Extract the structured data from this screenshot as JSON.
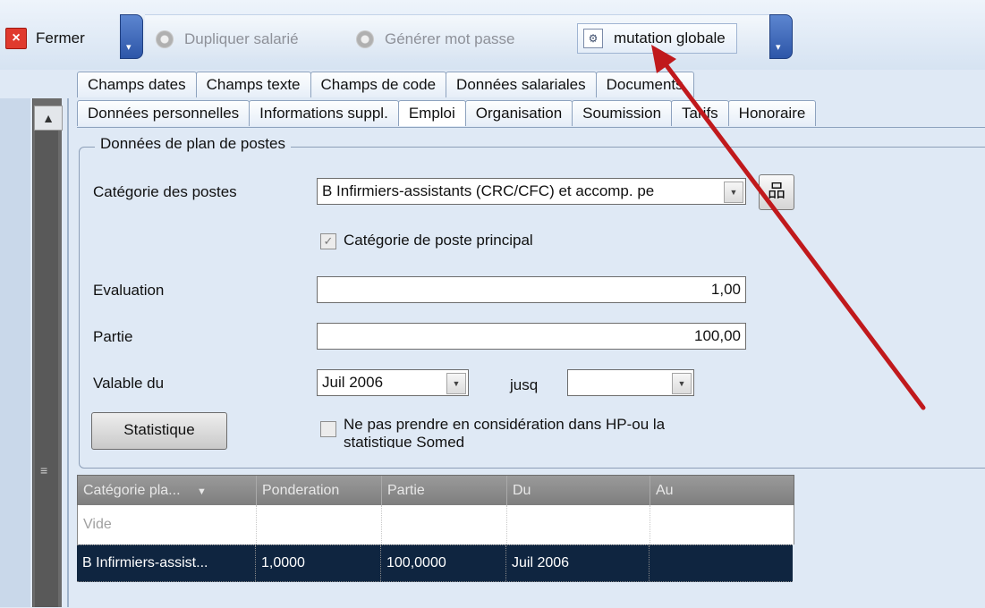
{
  "toolbar": {
    "close_label": "Fermer",
    "duplicate_label": "Dupliquer salarié",
    "generate_password_label": "Générer mot passe",
    "mutation_label": "mutation globale",
    "split_arrow": "▾"
  },
  "tabs_row1": [
    "Champs dates",
    "Champs texte",
    "Champs de code",
    "Données salariales",
    "Documents"
  ],
  "tabs_row2": [
    "Données personnelles",
    "Informations suppl.",
    "Emploi",
    "Organisation",
    "Soumission",
    "Tarifs",
    "Honoraire"
  ],
  "groupbox": {
    "title": "Données de plan de postes",
    "category_label": "Catégorie des postes",
    "category_value": "B Infirmiers-assistants (CRC/CFC) et accomp. pe",
    "main_category_label": "Catégorie de poste principal",
    "main_category_checked": "✓",
    "evaluation_label": "Evaluation",
    "evaluation_value": "1,00",
    "partie_label": "Partie",
    "partie_value": "100,00",
    "valid_from_label": "Valable du",
    "valid_from_value": "Juil 2006",
    "until_label": "jusq",
    "until_value": "",
    "statistic_button": "Statistique",
    "exclude_label_line1": "Ne pas prendre en considération dans HP-ou la",
    "exclude_label_line2": "statistique Somed"
  },
  "grid": {
    "headers": [
      "Catégorie pla...",
      "Ponderation",
      "Partie",
      "Du",
      "Au"
    ],
    "sort_glyph": "▼",
    "empty_text": "Vide",
    "row": [
      "B Infirmiers-assist...",
      "1,0000",
      "100,0000",
      "Juil 2006",
      ""
    ]
  },
  "colors": {
    "arrow": "#c0191c",
    "selected_row": "#0f2540"
  }
}
